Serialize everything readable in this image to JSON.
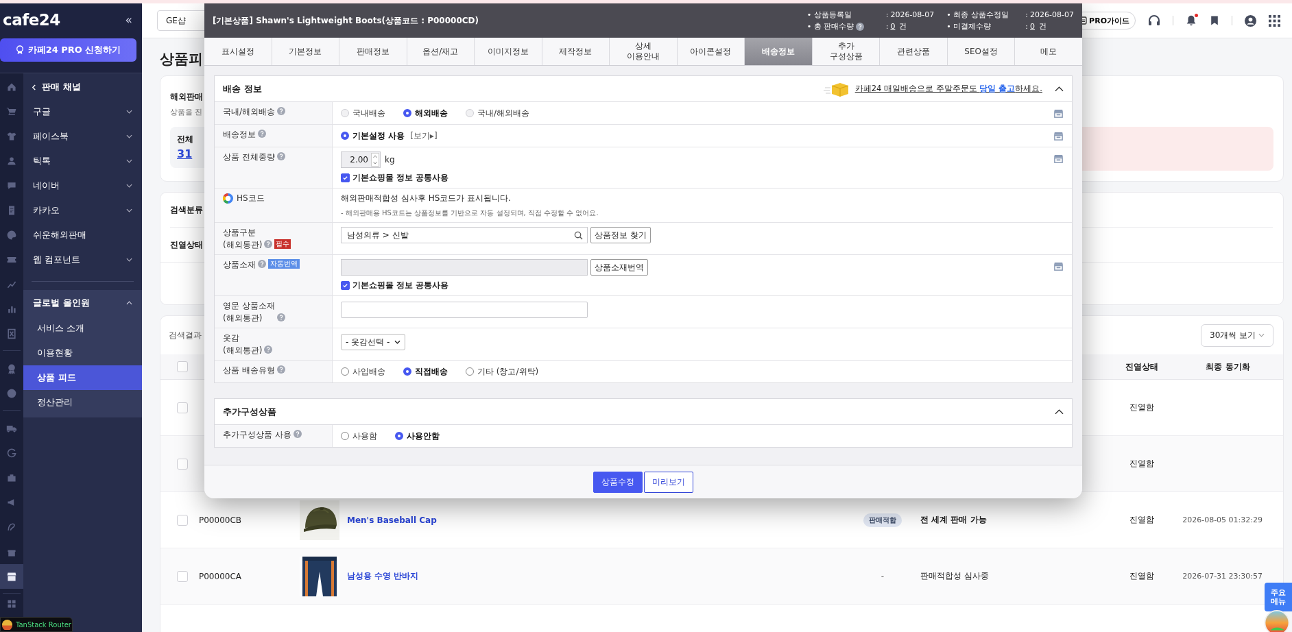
{
  "icon_rail": [
    {
      "selected": false
    },
    {
      "selected": false
    },
    {
      "selected": false
    },
    {
      "selected": false
    },
    {
      "selected": false
    },
    {
      "selected": false
    },
    {
      "selected": false
    },
    {
      "selected": false
    },
    {
      "selected": false
    },
    {
      "selected": false
    },
    {
      "selected": false
    },
    {
      "selected": false
    },
    {
      "selected": false
    },
    {
      "selected": false
    },
    {
      "selected": false
    },
    {
      "selected": false
    },
    {
      "selected": false
    },
    {
      "selected": false
    },
    {
      "selected": false
    },
    {
      "selected": true
    },
    {
      "selected": false
    }
  ],
  "sidebar": {
    "logo": "cafe24",
    "collapse": "«",
    "pro_button": "카페24 PRO 신청하기",
    "back_label": "판매 채널",
    "items": [
      {
        "label": "구글",
        "expanded": false
      },
      {
        "label": "페이스북",
        "expanded": false
      },
      {
        "label": "틱톡",
        "expanded": false
      },
      {
        "label": "네이버",
        "expanded": false
      },
      {
        "label": "카카오",
        "expanded": false
      },
      {
        "label": "쉬운해외판매"
      },
      {
        "label": "웹 컴포넌트",
        "expanded": false
      }
    ],
    "group": {
      "label": "글로벌 올인원",
      "expanded": true,
      "children": [
        {
          "label": "서비스 소개",
          "selected": false
        },
        {
          "label": "이용현황",
          "selected": false
        },
        {
          "label": "상품 피드",
          "selected": true
        },
        {
          "label": "정산관리",
          "selected": false
        }
      ]
    }
  },
  "topbar": {
    "shop_select": "GE샵",
    "pro_guide": "PRO가이드",
    "notification_dot": true
  },
  "page_title": "상품피",
  "summary": {
    "title": "해외판매",
    "subtitle": "상품을 진",
    "stat_label": "전체",
    "stat_value": "31"
  },
  "filters": [
    "검색분류",
    "진열상태"
  ],
  "results": {
    "label": "검색결과",
    "page_size": "30개씩 보기",
    "all_checked": false,
    "columns": [
      "진열상태",
      "최종 동기화"
    ],
    "rows": [
      {
        "checked": false,
        "display": "진열함"
      },
      {
        "checked": false,
        "display": "진열함"
      },
      {
        "checked": false,
        "code": "P00000CB",
        "name": "Men's Baseball Cap",
        "fit": {
          "text": "판매적합",
          "kind": "pill"
        },
        "status": {
          "text": "전 세계 판매 가능",
          "kind": "approved"
        },
        "display": "진열함",
        "synced": "2026-08-05 01:32:29"
      },
      {
        "checked": false,
        "code": "P00000CA",
        "name": "남성용 수영 반바지",
        "fit": {
          "text": "-",
          "kind": "plain"
        },
        "status": {
          "text": "판매적합성 심사중",
          "kind": "pending"
        },
        "display": "진열함",
        "synced": "2026-07-31 23:30:57"
      }
    ]
  },
  "modal": {
    "title": "[기본상품] Shawn's Lightweight Boots(상품코드 : P00000CD)",
    "meta": [
      {
        "label": "• 상품등록일",
        "help": false,
        "colon": ":",
        "value": "2026-08-07",
        "link": false
      },
      {
        "label": "• 최종 상품수정일",
        "help": false,
        "colon": ":",
        "value": "2026-08-07",
        "link": false
      },
      {
        "label": "• 총 판매수량",
        "help": true,
        "colon": ":",
        "value": "0",
        "unit": "건",
        "link": true
      },
      {
        "label": "• 미결제수량",
        "help": false,
        "colon": ":",
        "value": "0",
        "unit": "건",
        "link": true
      }
    ],
    "tabs": [
      {
        "label": "표시설정",
        "selected": false
      },
      {
        "label": "기본정보",
        "selected": false
      },
      {
        "label": "판매정보",
        "selected": false
      },
      {
        "label": "옵션/재고",
        "selected": false
      },
      {
        "label": "이미지정보",
        "selected": false
      },
      {
        "label": "제작정보",
        "selected": false
      },
      {
        "label": "상세\n이용안내",
        "selected": false
      },
      {
        "label": "아이콘설정",
        "selected": false
      },
      {
        "label": "배송정보",
        "selected": true
      },
      {
        "label": "추가\n구성상품",
        "selected": false
      },
      {
        "label": "관련상품",
        "selected": false
      },
      {
        "label": "SEO설정",
        "selected": false
      },
      {
        "label": "메모",
        "selected": false
      }
    ],
    "sections": [
      {
        "title": "배송 정보",
        "expanded": true,
        "promo": "카페24 매일배송으로 주말주문도 **당일 출고**하세요.",
        "rows": [
          {
            "kind": "radio",
            "label": "국내/해외배송",
            "help": true,
            "shop_button": true,
            "options": [
              {
                "label": "국내배송",
                "selected": false,
                "disabled": true
              },
              {
                "label": "해외배송",
                "selected": true,
                "disabled": false
              },
              {
                "label": "국내/해외배송",
                "selected": false,
                "disabled": true
              }
            ]
          },
          {
            "kind": "radio",
            "label": "배송정보",
            "help": true,
            "shop_button": true,
            "options": [
              {
                "label": "기본설정 사용",
                "selected": true,
                "disabled": false
              }
            ],
            "link": "[보기▸]"
          },
          {
            "kind": "weight",
            "label": "상품 전체중량",
            "help": true,
            "shop_button": true,
            "value": "2.00",
            "unit": "kg",
            "checkbox": {
              "label": "기본쇼핑몰 정보 공통사용",
              "checked": true
            }
          },
          {
            "kind": "note",
            "label": "HS코드",
            "help": false,
            "shop_button": false,
            "text": "해외판매적합성 심사후 HS코드가 표시됩니다.",
            "note": "- 해외판매용 HS코드는 상품정보를 기반으로 자동 설정되며, 직접 수정할 수 없어요."
          },
          {
            "kind": "search",
            "label": "상품구분\n(해외통관)",
            "help": true,
            "badge": {
              "text": "필수",
              "kind": "required"
            },
            "shop_button": false,
            "value": "남성의류 > 신발",
            "button": "상품정보 찾기"
          },
          {
            "kind": "material",
            "label": "상품소재",
            "help": true,
            "badge": {
              "text": "자동번역",
              "kind": "auto"
            },
            "shop_button": true,
            "field_disabled": true,
            "button": "상품소재번역",
            "checkbox": {
              "label": "기본쇼핑몰 정보 공통사용",
              "checked": true
            }
          },
          {
            "kind": "text",
            "label": "영문 상품소재\n(해외통관)",
            "help": true,
            "shop_button": false
          },
          {
            "kind": "select",
            "label": "옷감\n(해외통관)",
            "help": true,
            "shop_button": false,
            "value": "- 옷감선택 -"
          },
          {
            "kind": "radio",
            "label": "상품 배송유형",
            "help": true,
            "shop_button": false,
            "options": [
              {
                "label": "사입배송",
                "selected": false,
                "disabled": false
              },
              {
                "label": "직접배송",
                "selected": true,
                "disabled": false
              },
              {
                "label": "기타 (창고/위탁)",
                "selected": false,
                "disabled": false
              }
            ]
          }
        ]
      },
      {
        "title": "추가구성상품",
        "expanded": true,
        "rows": [
          {
            "kind": "radio",
            "label": "추가구성상품 사용",
            "help": true,
            "shop_button": false,
            "options": [
              {
                "label": "사용함",
                "selected": false,
                "disabled": false
              },
              {
                "label": "사용안함",
                "selected": true,
                "disabled": false
              }
            ]
          }
        ]
      }
    ],
    "buttons": [
      {
        "label": "상품수정",
        "kind": "primary"
      },
      {
        "label": "미리보기",
        "kind": "outline"
      }
    ]
  },
  "devtools": "TanStack Router",
  "quick_menu": "주요\n메뉴"
}
